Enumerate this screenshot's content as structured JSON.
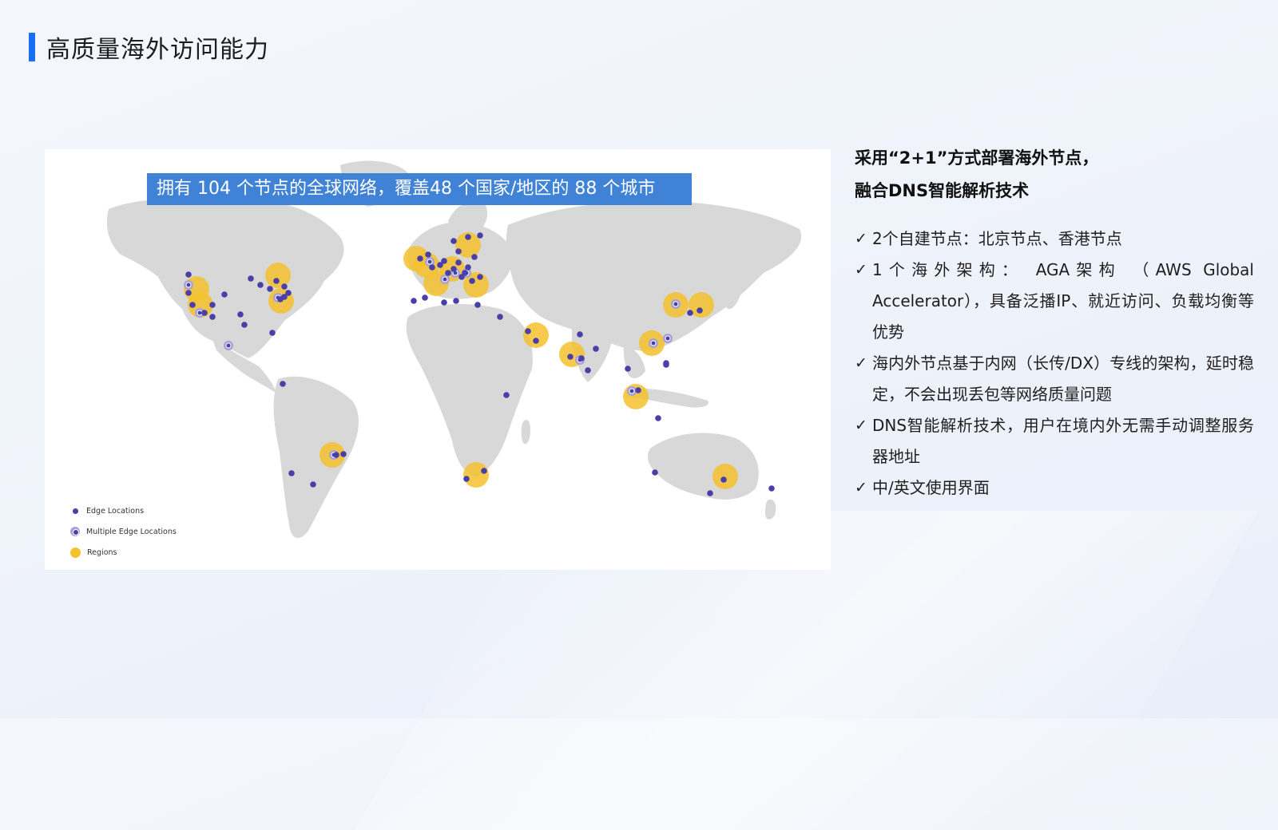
{
  "page": {
    "title": "高质量海外访问能力"
  },
  "map": {
    "banner": "拥有 104 个节点的全球网络，覆盖48 个国家/地区的 88 个城市",
    "legend": [
      {
        "label": "Edge Locations"
      },
      {
        "label": "Multiple Edge Locations"
      },
      {
        "label": "Regions"
      }
    ],
    "colors": {
      "edge": "#4a3fa8",
      "multiple": "#a7a2d4",
      "region": "#f4c22e",
      "land": "#d8d8d8"
    }
  },
  "right": {
    "heading_line1": "采用“2+1”方式部署海外节点，",
    "heading_line2": "融合DNS智能解析技术",
    "check_mark": "✓",
    "items": [
      "2个自建节点：北京节点、香港节点",
      "1个海外架构： AGA架构 （AWS Global Accelerator），具备泛播IP、就近访问、负载均衡等优势",
      "海内外节点基于内网（长传/DX）专线的架构，延时稳定，不会出现丢包等网络质量问题",
      "DNS智能解析技术，用户在境内外无需手动调整服务器地址",
      "中/英文使用界面"
    ]
  }
}
